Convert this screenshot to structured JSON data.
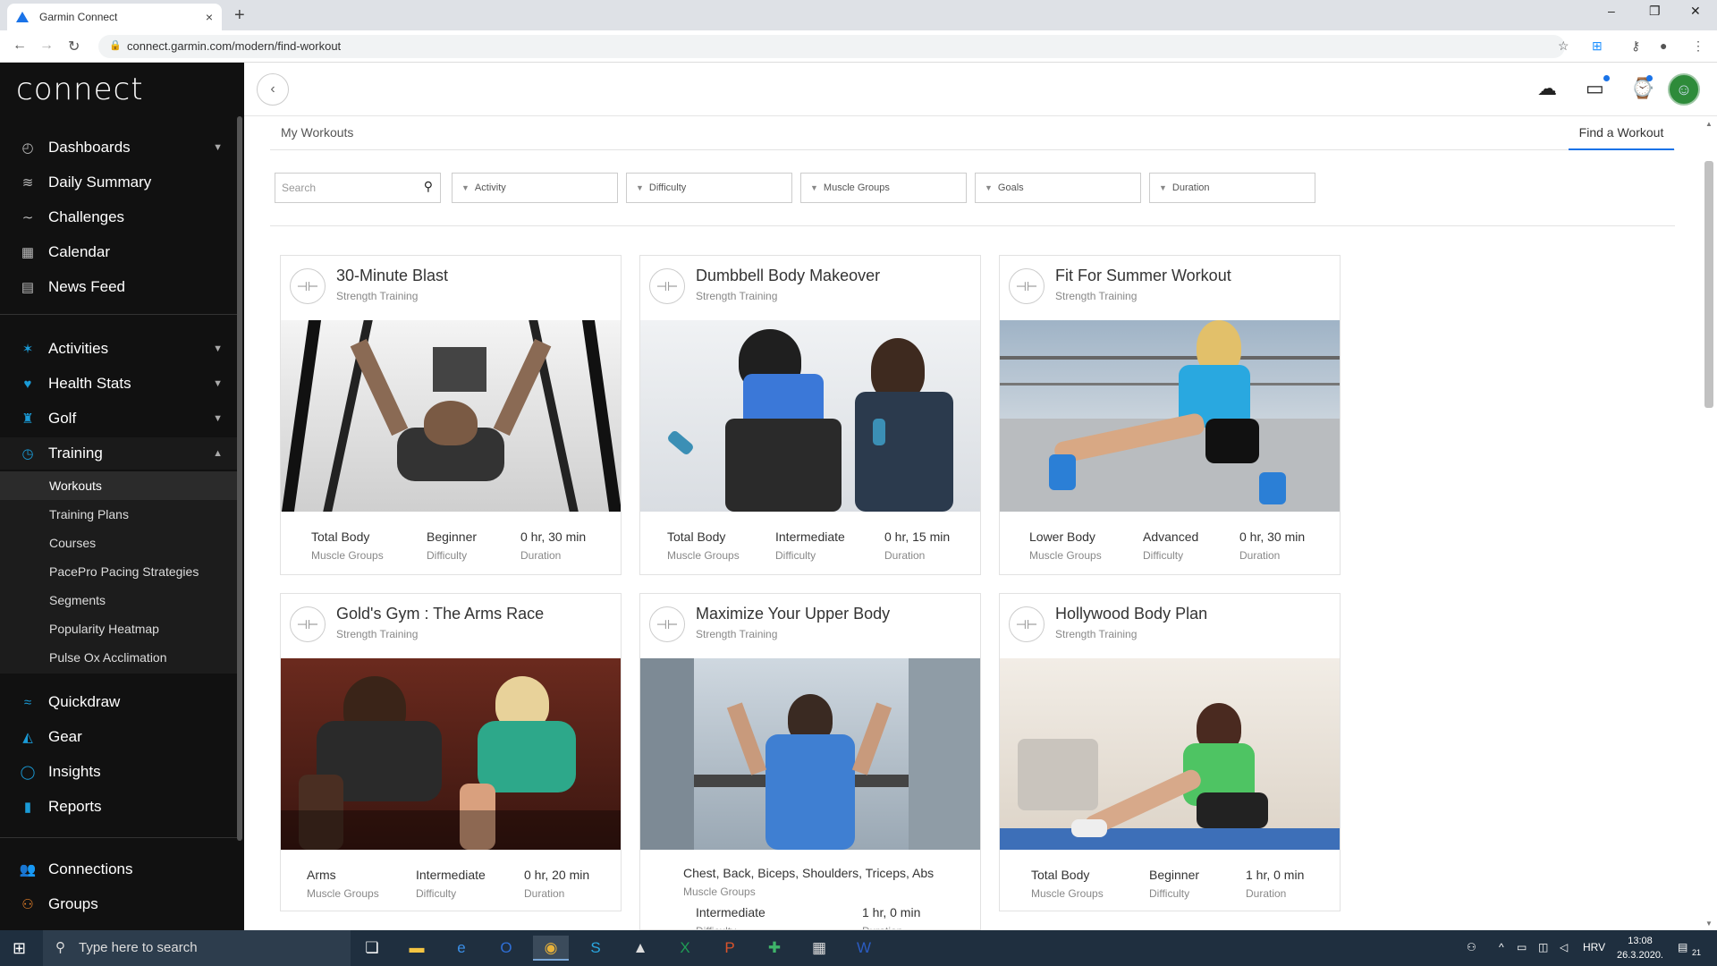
{
  "browser": {
    "tab_title": "Garmin Connect",
    "tab_close": "×",
    "new_tab": "+",
    "url": "connect.garmin.com/modern/find-workout",
    "minimize": "–",
    "restore": "❐",
    "close": "✕"
  },
  "sidebar": {
    "logo": "connect",
    "items": [
      {
        "label": "Dashboards",
        "icon": "dashboard-icon"
      },
      {
        "label": "Daily Summary",
        "icon": "layers-icon"
      },
      {
        "label": "Challenges",
        "icon": "challenges-icon"
      },
      {
        "label": "Calendar",
        "icon": "calendar-icon"
      },
      {
        "label": "News Feed",
        "icon": "newsfeed-icon"
      },
      {
        "label": "Activities",
        "icon": "runner-icon"
      },
      {
        "label": "Health Stats",
        "icon": "heart-icon"
      },
      {
        "label": "Golf",
        "icon": "golfer-icon"
      },
      {
        "label": "Training",
        "icon": "stopwatch-icon"
      },
      {
        "label": "Quickdraw",
        "icon": "quickdraw-icon"
      },
      {
        "label": "Gear",
        "icon": "shoe-icon"
      },
      {
        "label": "Insights",
        "icon": "lightbulb-icon"
      },
      {
        "label": "Reports",
        "icon": "bar-chart-icon"
      },
      {
        "label": "Connections",
        "icon": "people-icon"
      },
      {
        "label": "Groups",
        "icon": "groups-icon"
      }
    ],
    "training_sub": [
      "Workouts",
      "Training Plans",
      "Courses",
      "PacePro Pacing Strategies",
      "Segments",
      "Popularity Heatmap",
      "Pulse Ox Acclimation"
    ]
  },
  "tabs": {
    "my_workouts": "My Workouts",
    "find_workout": "Find a Workout"
  },
  "filters": {
    "search_placeholder": "Search",
    "activity": "Activity",
    "difficulty": "Difficulty",
    "muscle_groups": "Muscle Groups",
    "goals": "Goals",
    "duration": "Duration"
  },
  "labels": {
    "muscle_groups": "Muscle Groups",
    "difficulty": "Difficulty",
    "duration": "Duration"
  },
  "workouts": [
    {
      "title": "30-Minute Blast",
      "type": "Strength Training",
      "muscle": "Total Body",
      "difficulty": "Beginner",
      "duration": "0 hr, 30 min"
    },
    {
      "title": "Dumbbell Body Makeover",
      "type": "Strength Training",
      "muscle": "Total Body",
      "difficulty": "Intermediate",
      "duration": "0 hr, 15 min"
    },
    {
      "title": "Fit For Summer Workout",
      "type": "Strength Training",
      "muscle": "Lower Body",
      "difficulty": "Advanced",
      "duration": "0 hr, 30 min"
    },
    {
      "title": "Gold's Gym : The Arms Race",
      "type": "Strength Training",
      "muscle": "Arms",
      "difficulty": "Intermediate",
      "duration": "0 hr, 20 min"
    },
    {
      "title": "Maximize Your Upper Body",
      "type": "Strength Training",
      "muscle": "Chest, Back, Biceps, Shoulders, Triceps, Abs",
      "difficulty": "Intermediate",
      "duration": "1 hr, 0 min"
    },
    {
      "title": "Hollywood Body Plan",
      "type": "Strength Training",
      "muscle": "Total Body",
      "difficulty": "Beginner",
      "duration": "1 hr, 0 min"
    }
  ],
  "taskbar": {
    "search_placeholder": "Type here to search",
    "lang": "HRV",
    "time": "13:08",
    "date": "26.3.2020.",
    "notif_count": "21"
  },
  "colors": {
    "accent": "#1a73e8",
    "sidebar_bg": "#111111",
    "garmin_blue": "#1a9bd7"
  }
}
